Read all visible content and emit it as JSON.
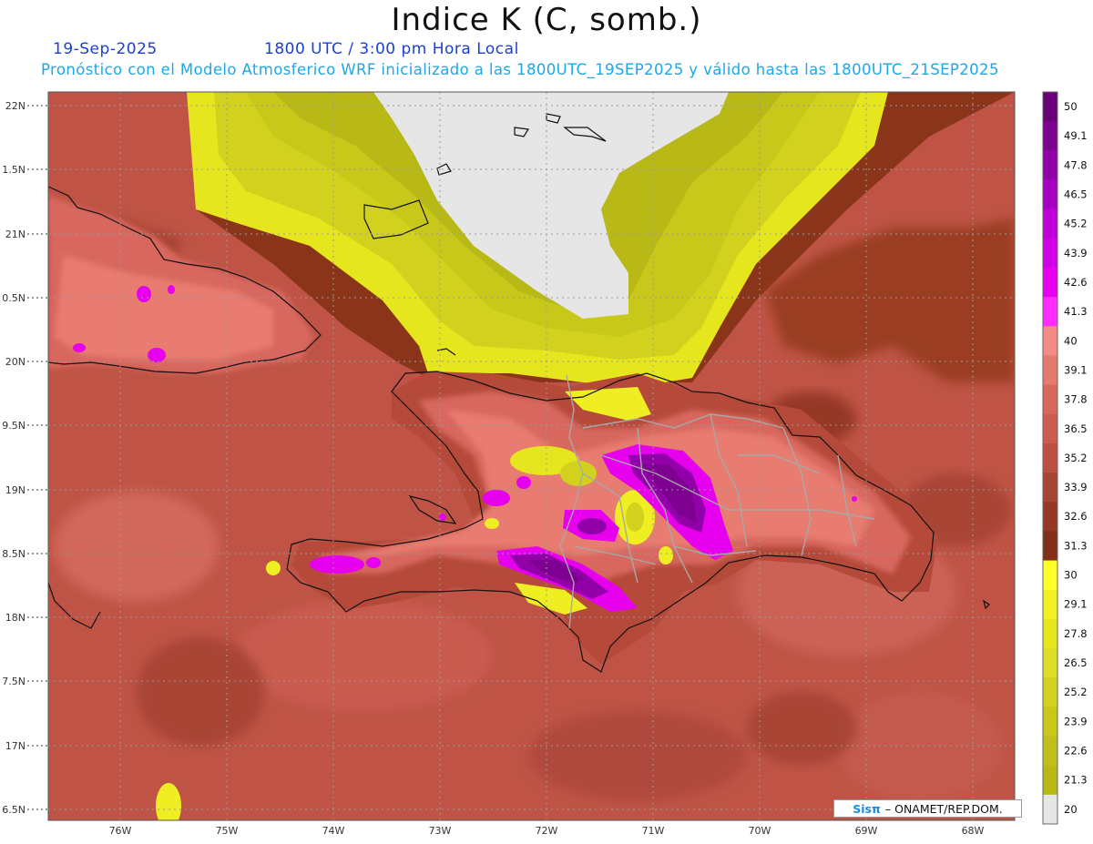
{
  "title": "Indice K (C, somb.)",
  "date_label": "19-Sep-2025",
  "time_label": "1800 UTC / 3:00 pm Hora Local",
  "forecast_label": "Pronóstico con el Modelo Atmosferico WRF inicializado a las 1800UTC_19SEP2025 y válido hasta las  1800UTC_21SEP2025",
  "credit": {
    "brand": "Sisπ",
    "text": "ONAMET/REP.DOM."
  },
  "lat_ticks": [
    "22N",
    "1.5N",
    "21N",
    "0.5N",
    "20N",
    "9.5N",
    "19N",
    "8.5N",
    "18N",
    "7.5N",
    "17N",
    "6.5N"
  ],
  "lon_ticks": [
    "76W",
    "75W",
    "74W",
    "73W",
    "72W",
    "71W",
    "70W",
    "69W",
    "68W"
  ],
  "colorbar": {
    "labels": [
      "50",
      "49.1",
      "47.8",
      "46.5",
      "45.2",
      "43.9",
      "42.6",
      "41.3",
      "40",
      "39.1",
      "37.8",
      "36.5",
      "35.2",
      "33.9",
      "32.6",
      "31.3",
      "30",
      "29.1",
      "27.8",
      "26.5",
      "25.2",
      "23.9",
      "22.6",
      "21.3",
      "20"
    ],
    "colors": [
      "#6a0078",
      "#7d0090",
      "#9200aa",
      "#a800c2",
      "#bf00d8",
      "#d200e6",
      "#e600ee",
      "#ff2cff",
      "#f28c84",
      "#e67a70",
      "#d8685e",
      "#cc5c50",
      "#bd5042",
      "#a84434",
      "#963826",
      "#82301a",
      "#ffff2a",
      "#f2f222",
      "#e6e61e",
      "#dede26",
      "#d2d21e",
      "#c8c81a",
      "#c0c01a",
      "#b8b816",
      "#e6e6e6"
    ]
  },
  "colors": {
    "ocean": "#bf5446",
    "ocean_dark": "#8a3519",
    "land_light": "#e87c70",
    "yellow": "#eeee22",
    "low": "#e6e6e6",
    "purple": "#7a0090",
    "magenta": "#e600ee"
  }
}
